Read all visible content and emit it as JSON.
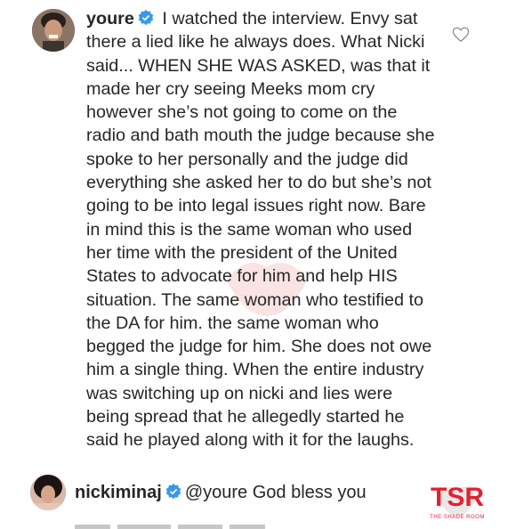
{
  "comment": {
    "username": "youre",
    "text": "I watched the interview. Envy sat there a lied like he always does. What Nicki said... WHEN SHE WAS ASKED, was that it made her cry seeing Meeks mom cry however she’s not going to come on the radio and bath mouth the judge because she spoke to her personally and the judge did everything she asked her to do but she’s not going to be into legal issues right now. Bare in mind this is the same woman who used her time with the president of the United States to advocate for him and help HIS situation. The same woman who testified to the DA for him. the same woman who begged the judge for him. She does not owe him a single thing. When the entire industry was switching up on nicki and lies were being spread that he allegedly started he said he played along with it for the laughs.",
    "like_icon": "heart-outline-icon",
    "verified_icon": "verified-badge-icon"
  },
  "reply": {
    "username": "nickiminaj",
    "mention": "@youre",
    "text": "God bless you",
    "verified_icon": "verified-badge-icon"
  },
  "watermark": {
    "logo_text": "TSR",
    "tagline": "THE SHADE ROOM"
  },
  "colors": {
    "text": "#262626",
    "verified_blue": "#3897f0",
    "tsr_red": "#e5202e",
    "tsr_dark": "#1a1a1a"
  }
}
